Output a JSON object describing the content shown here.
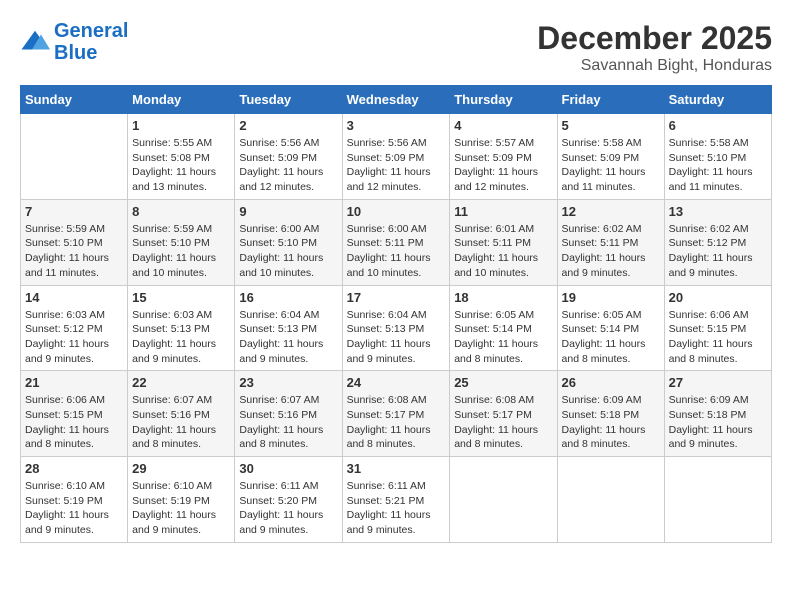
{
  "logo": {
    "line1": "General",
    "line2": "Blue"
  },
  "title": "December 2025",
  "location": "Savannah Bight, Honduras",
  "days_of_week": [
    "Sunday",
    "Monday",
    "Tuesday",
    "Wednesday",
    "Thursday",
    "Friday",
    "Saturday"
  ],
  "weeks": [
    [
      {
        "day": "",
        "info": ""
      },
      {
        "day": "1",
        "info": "Sunrise: 5:55 AM\nSunset: 5:08 PM\nDaylight: 11 hours\nand 13 minutes."
      },
      {
        "day": "2",
        "info": "Sunrise: 5:56 AM\nSunset: 5:09 PM\nDaylight: 11 hours\nand 12 minutes."
      },
      {
        "day": "3",
        "info": "Sunrise: 5:56 AM\nSunset: 5:09 PM\nDaylight: 11 hours\nand 12 minutes."
      },
      {
        "day": "4",
        "info": "Sunrise: 5:57 AM\nSunset: 5:09 PM\nDaylight: 11 hours\nand 12 minutes."
      },
      {
        "day": "5",
        "info": "Sunrise: 5:58 AM\nSunset: 5:09 PM\nDaylight: 11 hours\nand 11 minutes."
      },
      {
        "day": "6",
        "info": "Sunrise: 5:58 AM\nSunset: 5:10 PM\nDaylight: 11 hours\nand 11 minutes."
      }
    ],
    [
      {
        "day": "7",
        "info": "Sunrise: 5:59 AM\nSunset: 5:10 PM\nDaylight: 11 hours\nand 11 minutes."
      },
      {
        "day": "8",
        "info": "Sunrise: 5:59 AM\nSunset: 5:10 PM\nDaylight: 11 hours\nand 10 minutes."
      },
      {
        "day": "9",
        "info": "Sunrise: 6:00 AM\nSunset: 5:10 PM\nDaylight: 11 hours\nand 10 minutes."
      },
      {
        "day": "10",
        "info": "Sunrise: 6:00 AM\nSunset: 5:11 PM\nDaylight: 11 hours\nand 10 minutes."
      },
      {
        "day": "11",
        "info": "Sunrise: 6:01 AM\nSunset: 5:11 PM\nDaylight: 11 hours\nand 10 minutes."
      },
      {
        "day": "12",
        "info": "Sunrise: 6:02 AM\nSunset: 5:11 PM\nDaylight: 11 hours\nand 9 minutes."
      },
      {
        "day": "13",
        "info": "Sunrise: 6:02 AM\nSunset: 5:12 PM\nDaylight: 11 hours\nand 9 minutes."
      }
    ],
    [
      {
        "day": "14",
        "info": "Sunrise: 6:03 AM\nSunset: 5:12 PM\nDaylight: 11 hours\nand 9 minutes."
      },
      {
        "day": "15",
        "info": "Sunrise: 6:03 AM\nSunset: 5:13 PM\nDaylight: 11 hours\nand 9 minutes."
      },
      {
        "day": "16",
        "info": "Sunrise: 6:04 AM\nSunset: 5:13 PM\nDaylight: 11 hours\nand 9 minutes."
      },
      {
        "day": "17",
        "info": "Sunrise: 6:04 AM\nSunset: 5:13 PM\nDaylight: 11 hours\nand 9 minutes."
      },
      {
        "day": "18",
        "info": "Sunrise: 6:05 AM\nSunset: 5:14 PM\nDaylight: 11 hours\nand 8 minutes."
      },
      {
        "day": "19",
        "info": "Sunrise: 6:05 AM\nSunset: 5:14 PM\nDaylight: 11 hours\nand 8 minutes."
      },
      {
        "day": "20",
        "info": "Sunrise: 6:06 AM\nSunset: 5:15 PM\nDaylight: 11 hours\nand 8 minutes."
      }
    ],
    [
      {
        "day": "21",
        "info": "Sunrise: 6:06 AM\nSunset: 5:15 PM\nDaylight: 11 hours\nand 8 minutes."
      },
      {
        "day": "22",
        "info": "Sunrise: 6:07 AM\nSunset: 5:16 PM\nDaylight: 11 hours\nand 8 minutes."
      },
      {
        "day": "23",
        "info": "Sunrise: 6:07 AM\nSunset: 5:16 PM\nDaylight: 11 hours\nand 8 minutes."
      },
      {
        "day": "24",
        "info": "Sunrise: 6:08 AM\nSunset: 5:17 PM\nDaylight: 11 hours\nand 8 minutes."
      },
      {
        "day": "25",
        "info": "Sunrise: 6:08 AM\nSunset: 5:17 PM\nDaylight: 11 hours\nand 8 minutes."
      },
      {
        "day": "26",
        "info": "Sunrise: 6:09 AM\nSunset: 5:18 PM\nDaylight: 11 hours\nand 8 minutes."
      },
      {
        "day": "27",
        "info": "Sunrise: 6:09 AM\nSunset: 5:18 PM\nDaylight: 11 hours\nand 9 minutes."
      }
    ],
    [
      {
        "day": "28",
        "info": "Sunrise: 6:10 AM\nSunset: 5:19 PM\nDaylight: 11 hours\nand 9 minutes."
      },
      {
        "day": "29",
        "info": "Sunrise: 6:10 AM\nSunset: 5:19 PM\nDaylight: 11 hours\nand 9 minutes."
      },
      {
        "day": "30",
        "info": "Sunrise: 6:11 AM\nSunset: 5:20 PM\nDaylight: 11 hours\nand 9 minutes."
      },
      {
        "day": "31",
        "info": "Sunrise: 6:11 AM\nSunset: 5:21 PM\nDaylight: 11 hours\nand 9 minutes."
      },
      {
        "day": "",
        "info": ""
      },
      {
        "day": "",
        "info": ""
      },
      {
        "day": "",
        "info": ""
      }
    ]
  ]
}
